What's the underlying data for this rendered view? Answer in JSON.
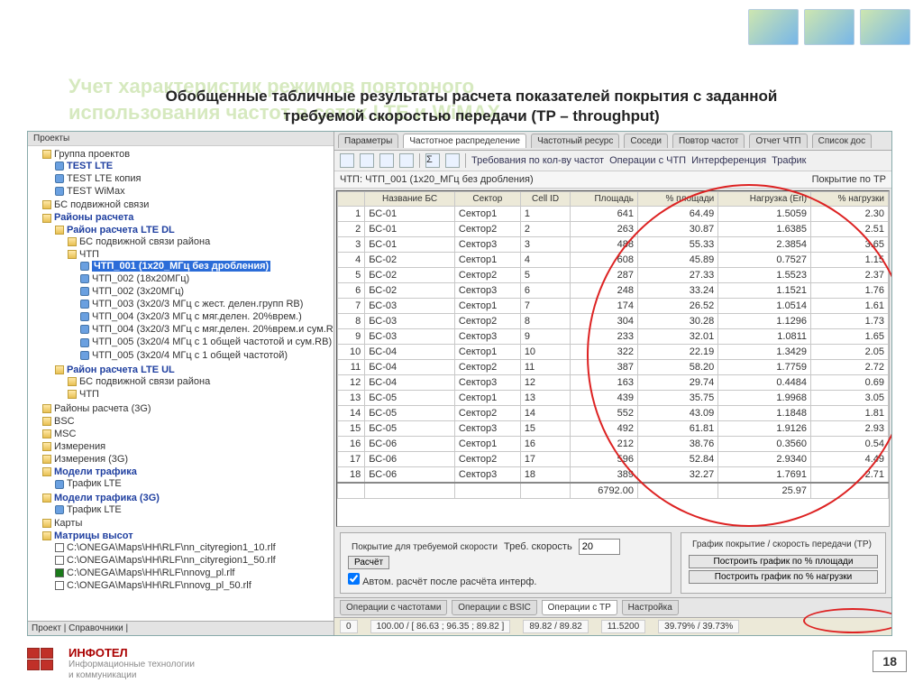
{
  "slide": {
    "bg_title_1": "Учет  характеристик режимов повторного",
    "bg_title_2": "использования частот в сетях LTE и WiMAX",
    "title_1": "Обобщенные табличные результаты расчета показателей покрытия с заданной",
    "title_2": "требуемой скоростью передачи (TP – throughput)",
    "page_number": "18"
  },
  "brand": {
    "name": "ИНФОТЕЛ",
    "sub1": "Информационные технологии",
    "sub2": "и коммуникации"
  },
  "leftpane": {
    "header": "Проекты",
    "group_root": "Группа проектов",
    "test_lte": "TEST LTE",
    "test_lte_copy": "TEST LTE копия",
    "test_wimax": "TEST WiMax",
    "bs_podv": "БС подвижной связи",
    "raion_rasch": "Районы расчета",
    "raion_lte_dl": "Район расчета LTE DL",
    "bs_podv_raiona": "БС подвижной связи района",
    "chtp": "ЧТП",
    "sel_chtp": "ЧТП_001 (1x20_МГц без дробления)",
    "chtp_items": [
      "ЧТП_002 (18x20МГц)",
      "ЧТП_002 (3x20МГц)",
      "ЧТП_003 (3x20/3 МГц с жест. делен.групп RB)",
      "ЧТП_004 (3x20/3 МГц с мяг.делен. 20%врем.)",
      "ЧТП_004 (3x20/3 МГц с мяг.делен. 20%врем.и сум.R",
      "ЧТП_005 (3x20/4 МГц с 1 общей частотой и сум.RB)",
      "ЧТП_005 (3x20/4 МГц с 1 общей частотой)"
    ],
    "raion_lte_ul": "Район расчета LTE UL",
    "bs_podv_raiona2": "БС подвижной связи района",
    "chtp2": "ЧТП",
    "raion_3g": "Районы расчета (3G)",
    "bsc": "BSC",
    "msc": "MSC",
    "izm": "Измерения",
    "izm3g": "Измерения (3G)",
    "model_traf": "Модели трафика",
    "traf_lte": "Трафик LTE",
    "model_traf_3g": "Модели трафика (3G)",
    "traf_lte2": "Трафик LTE",
    "karty": "Карты",
    "matr": "Матрицы высот",
    "paths": [
      "C:\\ONEGA\\Maps\\HH\\RLF\\nn_cityregion1_10.rlf",
      "C:\\ONEGA\\Maps\\HH\\RLF\\nn_cityregion1_50.rlf",
      "C:\\ONEGA\\Maps\\HH\\RLF\\nnovg_pl.rlf",
      "C:\\ONEGA\\Maps\\HH\\RLF\\nnovg_pl_50.rlf"
    ],
    "bottom_tabs": "Проект | Справочники |"
  },
  "tabs": {
    "t1": "Параметры",
    "t2": "Частотное распределение",
    "t3": "Частотный ресурс",
    "t4": "Соседи",
    "t5": "Повтор частот",
    "t6": "Отчет ЧТП",
    "t7": "Список дос"
  },
  "toolbar2": {
    "l1": "Требования по кол-ву частот",
    "l2": "Операции с ЧТП",
    "l3": "Интерференция",
    "l4": "Трафик"
  },
  "subhdr": {
    "left": "ЧТП: ЧТП_001 (1x20_МГц без дробления)",
    "right": "Покрытие по TP"
  },
  "grid": {
    "headers": {
      "n": "",
      "bs": "Название БС",
      "sector": "Сектор",
      "cell": "Cell ID",
      "area": "Площадь",
      "pct": "% площади",
      "load": "Нагрузка (Erl)",
      "pctload": "% нагрузки"
    },
    "rows": [
      {
        "n": "1",
        "bs": "БС-01",
        "sec": "Сектор1",
        "cell": "1",
        "area": "641",
        "pct": "64.49",
        "load": "1.5059",
        "pl": "2.30"
      },
      {
        "n": "2",
        "bs": "БС-01",
        "sec": "Сектор2",
        "cell": "2",
        "area": "263",
        "pct": "30.87",
        "load": "1.6385",
        "pl": "2.51"
      },
      {
        "n": "3",
        "bs": "БС-01",
        "sec": "Сектор3",
        "cell": "3",
        "area": "488",
        "pct": "55.33",
        "load": "2.3854",
        "pl": "3.65"
      },
      {
        "n": "4",
        "bs": "БС-02",
        "sec": "Сектор1",
        "cell": "4",
        "area": "608",
        "pct": "45.89",
        "load": "0.7527",
        "pl": "1.15"
      },
      {
        "n": "5",
        "bs": "БС-02",
        "sec": "Сектор2",
        "cell": "5",
        "area": "287",
        "pct": "27.33",
        "load": "1.5523",
        "pl": "2.37"
      },
      {
        "n": "6",
        "bs": "БС-02",
        "sec": "Сектор3",
        "cell": "6",
        "area": "248",
        "pct": "33.24",
        "load": "1.1521",
        "pl": "1.76"
      },
      {
        "n": "7",
        "bs": "БС-03",
        "sec": "Сектор1",
        "cell": "7",
        "area": "174",
        "pct": "26.52",
        "load": "1.0514",
        "pl": "1.61"
      },
      {
        "n": "8",
        "bs": "БС-03",
        "sec": "Сектор2",
        "cell": "8",
        "area": "304",
        "pct": "30.28",
        "load": "1.1296",
        "pl": "1.73"
      },
      {
        "n": "9",
        "bs": "БС-03",
        "sec": "Сектор3",
        "cell": "9",
        "area": "233",
        "pct": "32.01",
        "load": "1.0811",
        "pl": "1.65"
      },
      {
        "n": "10",
        "bs": "БС-04",
        "sec": "Сектор1",
        "cell": "10",
        "area": "322",
        "pct": "22.19",
        "load": "1.3429",
        "pl": "2.05"
      },
      {
        "n": "11",
        "bs": "БС-04",
        "sec": "Сектор2",
        "cell": "11",
        "area": "387",
        "pct": "58.20",
        "load": "1.7759",
        "pl": "2.72"
      },
      {
        "n": "12",
        "bs": "БС-04",
        "sec": "Сектор3",
        "cell": "12",
        "area": "163",
        "pct": "29.74",
        "load": "0.4484",
        "pl": "0.69"
      },
      {
        "n": "13",
        "bs": "БС-05",
        "sec": "Сектор1",
        "cell": "13",
        "area": "439",
        "pct": "35.75",
        "load": "1.9968",
        "pl": "3.05"
      },
      {
        "n": "14",
        "bs": "БС-05",
        "sec": "Сектор2",
        "cell": "14",
        "area": "552",
        "pct": "43.09",
        "load": "1.1848",
        "pl": "1.81"
      },
      {
        "n": "15",
        "bs": "БС-05",
        "sec": "Сектор3",
        "cell": "15",
        "area": "492",
        "pct": "61.81",
        "load": "1.9126",
        "pl": "2.93"
      },
      {
        "n": "16",
        "bs": "БС-06",
        "sec": "Сектор1",
        "cell": "16",
        "area": "212",
        "pct": "38.76",
        "load": "0.3560",
        "pl": "0.54"
      },
      {
        "n": "17",
        "bs": "БС-06",
        "sec": "Сектор2",
        "cell": "17",
        "area": "596",
        "pct": "52.84",
        "load": "2.9340",
        "pl": "4.49"
      },
      {
        "n": "18",
        "bs": "БС-06",
        "sec": "Сектор3",
        "cell": "18",
        "area": "389",
        "pct": "32.27",
        "load": "1.7691",
        "pl": "2.71"
      }
    ],
    "totals": {
      "area": "6792.00",
      "load": "25.97"
    }
  },
  "fs1": {
    "legend": "Покрытие для требуемой скорости",
    "label": "Треб. скорость",
    "value": "20",
    "btn": "Расчёт",
    "cb": "Автом. расчёт после расчёта интерф."
  },
  "fs2": {
    "legend": "График покрытие / скорость передачи (TP)",
    "btn1": "Построить график по % площади",
    "btn2": "Построить график по % нагрузки"
  },
  "optabs": {
    "t1": "Операции с частотами",
    "t2": "Операции с BSIC",
    "t3": "Операции с TP",
    "t4": "Настройка"
  },
  "statusbar": {
    "c1": "0",
    "c2": "100.00 / [ 86.63 ; 96.35 ; 89.82 ]",
    "c3": "89.82 / 89.82",
    "c4": "11.5200",
    "c5": "39.79% / 39.73%"
  }
}
